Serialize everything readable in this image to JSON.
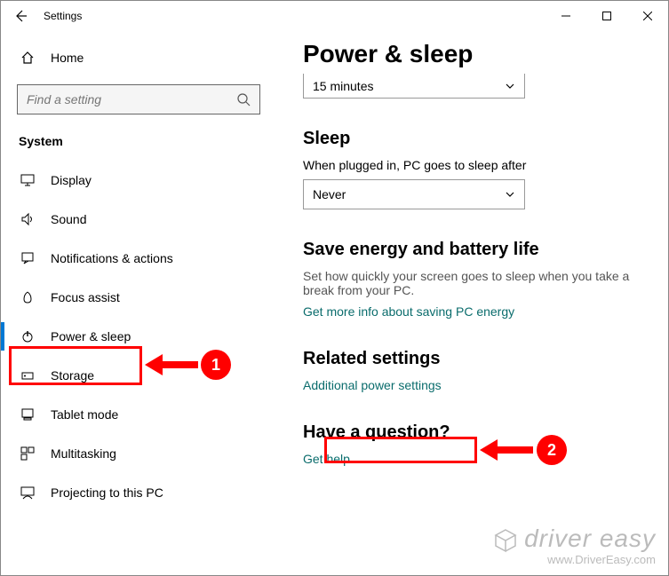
{
  "titlebar": {
    "title": "Settings"
  },
  "sidebar": {
    "home": "Home",
    "search_placeholder": "Find a setting",
    "group": "System",
    "items": [
      {
        "label": "Display"
      },
      {
        "label": "Sound"
      },
      {
        "label": "Notifications & actions"
      },
      {
        "label": "Focus assist"
      },
      {
        "label": "Power & sleep"
      },
      {
        "label": "Storage"
      },
      {
        "label": "Tablet mode"
      },
      {
        "label": "Multitasking"
      },
      {
        "label": "Projecting to this PC"
      }
    ]
  },
  "main": {
    "title": "Power & sleep",
    "screen_value": "15 minutes",
    "sleep": {
      "heading": "Sleep",
      "label": "When plugged in, PC goes to sleep after",
      "value": "Never"
    },
    "energy": {
      "heading": "Save energy and battery life",
      "desc": "Set how quickly your screen goes to sleep when you take a break from your PC.",
      "link": "Get more info about saving PC energy"
    },
    "related": {
      "heading": "Related settings",
      "link": "Additional power settings"
    },
    "question": {
      "heading": "Have a question?",
      "link": "Get help"
    }
  },
  "callouts": {
    "one": "1",
    "two": "2"
  },
  "watermark": {
    "line1": "driver easy",
    "line2": "www.DriverEasy.com"
  }
}
